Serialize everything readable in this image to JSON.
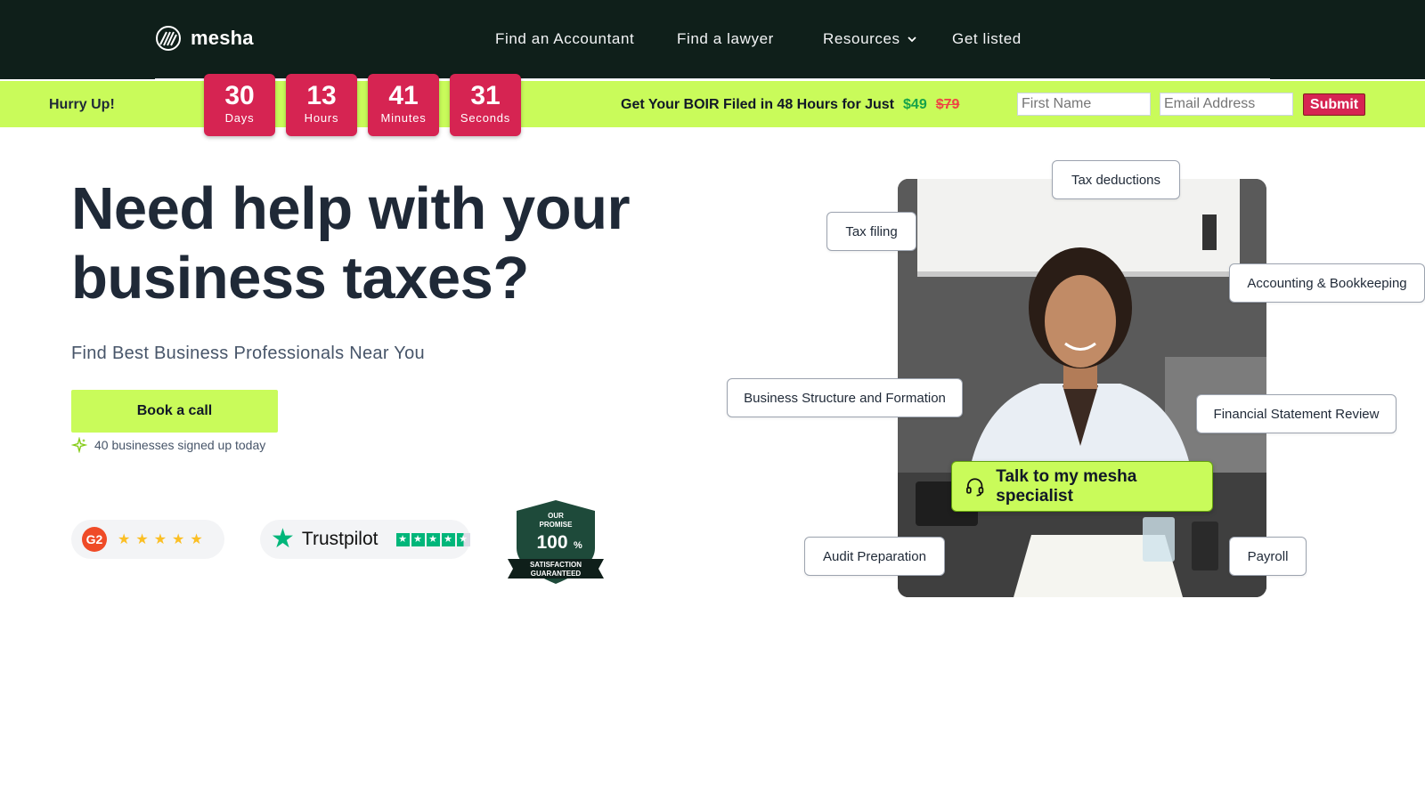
{
  "nav": {
    "logo_text": "mesha",
    "links": [
      {
        "label": "Find an Accountant"
      },
      {
        "label": "Find a lawyer"
      },
      {
        "label": "Resources"
      },
      {
        "label": "Get listed"
      }
    ]
  },
  "promo": {
    "hurry": "Hurry Up!",
    "countdown": [
      {
        "value": "30",
        "unit": "Days"
      },
      {
        "value": "13",
        "unit": "Hours"
      },
      {
        "value": "41",
        "unit": "Minutes"
      },
      {
        "value": "31",
        "unit": "Seconds"
      }
    ],
    "offer_text": "Get Your BOIR Filed in 48 Hours for Just",
    "price_new": "$49",
    "price_old": "$79",
    "first_name_placeholder": "First Name",
    "email_placeholder": "Email Address",
    "submit_label": "Submit"
  },
  "hero": {
    "headline_line1": "Need help with your",
    "headline_line2": "business taxes?",
    "subhead": "Find Best Business Professionals Near You",
    "cta_label": "Book a call",
    "signed_up": "40 businesses signed up today",
    "g2_label": "G2",
    "g2_rating": 5,
    "trustpilot_label": "Trustpilot",
    "trustpilot_rating": 4.5,
    "promise": {
      "line1": "OUR",
      "line2": "PROMISE",
      "percent": "100",
      "percent_sign": "%",
      "line3": "SATISFACTION",
      "line4": "GUARANTEED"
    }
  },
  "services": {
    "tax_deductions": "Tax deductions",
    "tax_filing": "Tax filing",
    "accounting": "Accounting & Bookkeeping",
    "business_structure": "Business Structure and Formation",
    "financial_review": "Financial Statement Review",
    "audit_prep": "Audit Preparation",
    "payroll": "Payroll"
  },
  "talk_label": "Talk to my mesha specialist",
  "colors": {
    "nav_bg": "#0f1f1a",
    "lime": "#c9fb5a",
    "countdown_red": "#d62452",
    "price_green": "#16a34a",
    "price_strike": "#ef4444",
    "trustpilot_green": "#00b67a",
    "promise_green": "#1e4a3a"
  }
}
